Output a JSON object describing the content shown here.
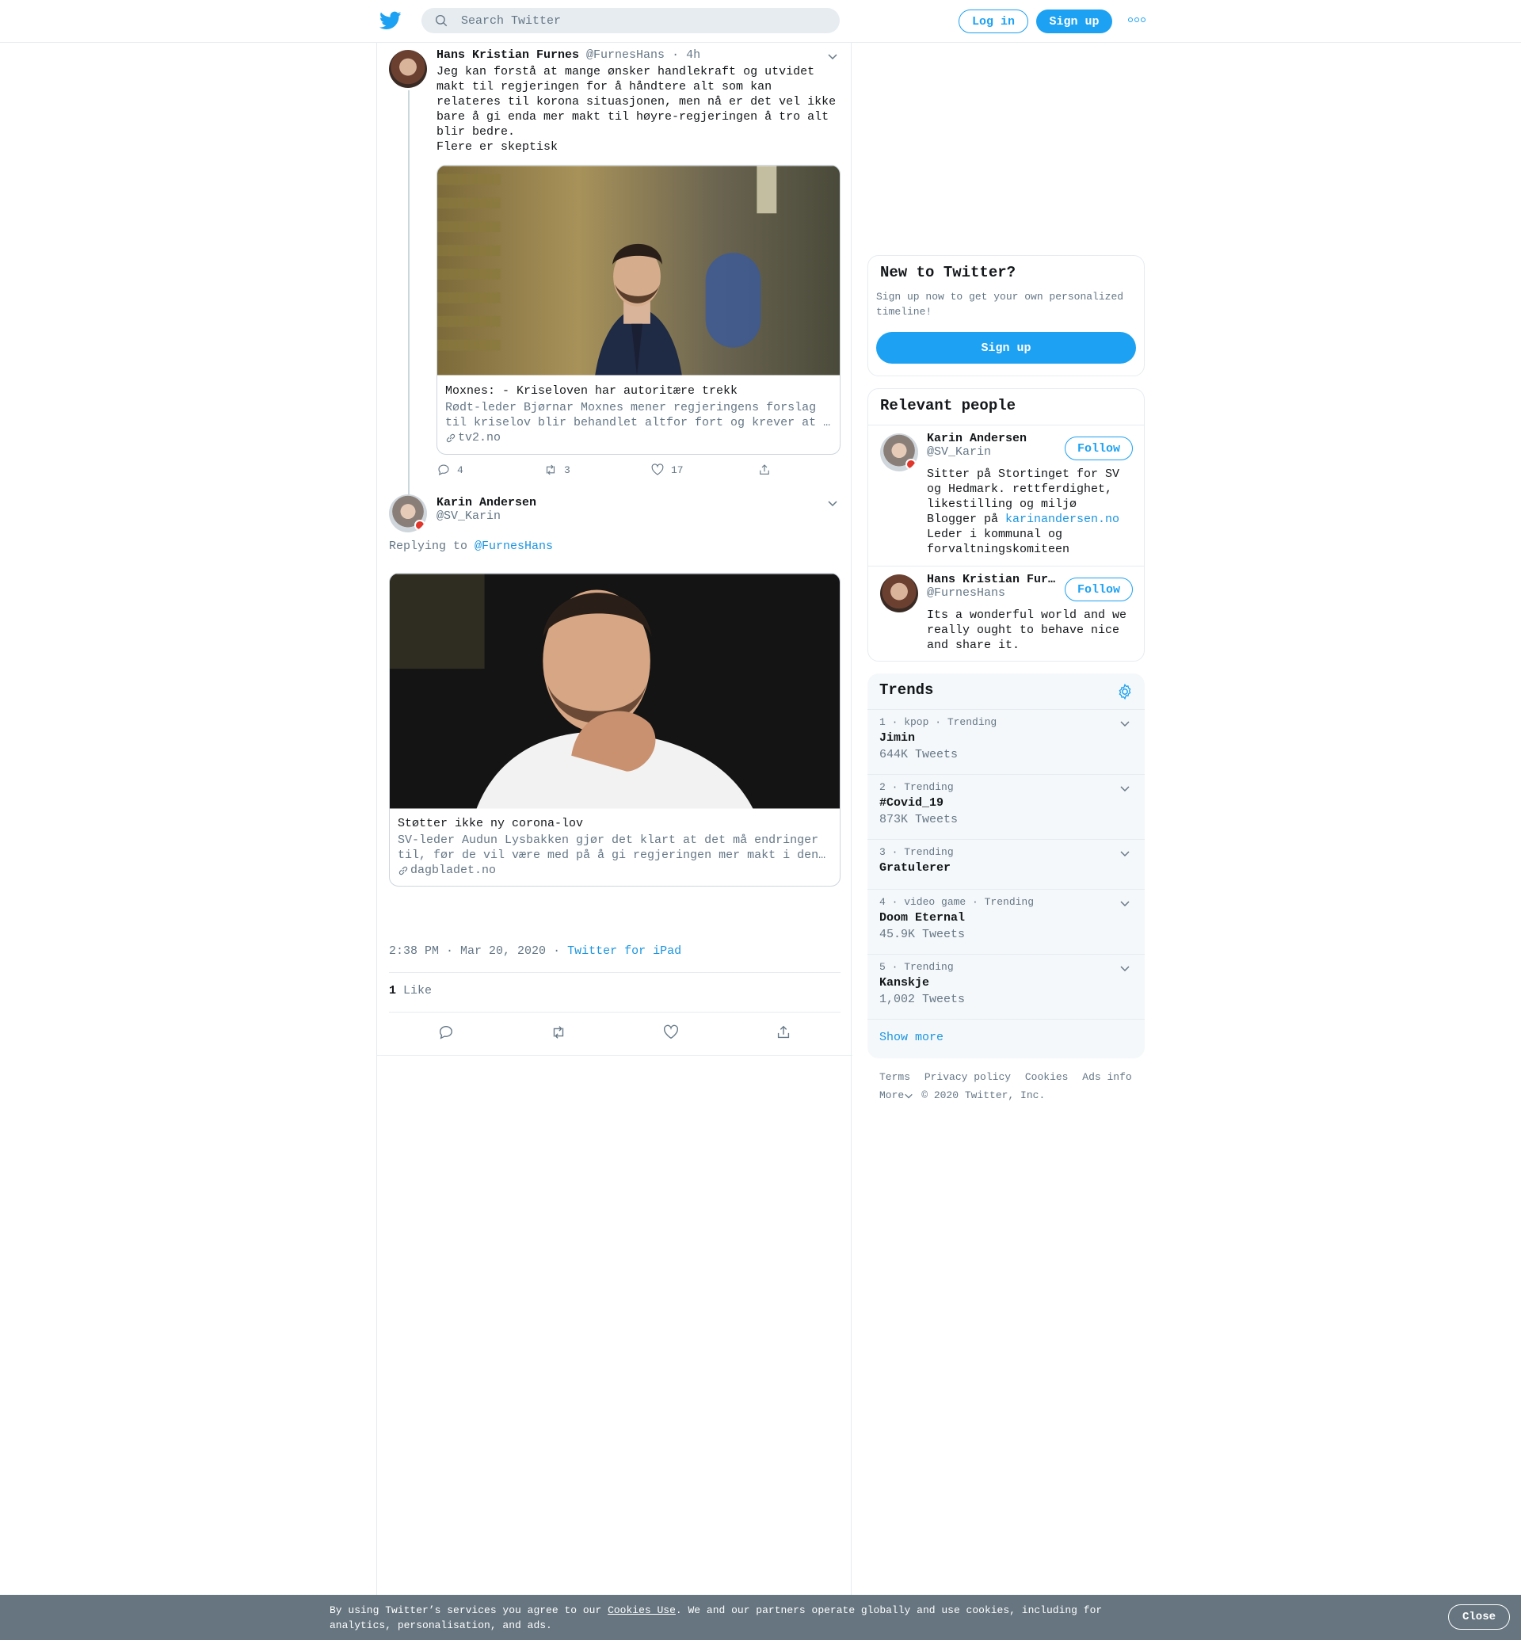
{
  "header": {
    "search_placeholder": "Search Twitter",
    "login_label": "Log in",
    "signup_label": "Sign up"
  },
  "parent_tweet": {
    "name": "Hans Kristian Furnes",
    "handle": "@FurnesHans",
    "time": "· 4h",
    "text": "Jeg kan forstå at mange ønsker handlekraft og utvidet\nmakt til regjeringen for å håndtere alt som kan\nrelateres til korona situasjonen, men nå er det vel ikke\nbare å gi enda mer makt til høyre-regjeringen å tro alt\nblir bedre.\nFlere er skeptisk",
    "card": {
      "title": "Moxnes: - Kriseloven har autoritære trekk",
      "description": "Rødt-leder Bjørnar Moxnes mener regjeringens forslag til kriselov blir behandlet altfor fort og krever at …",
      "domain": "tv2.no"
    },
    "replies": "4",
    "retweets": "3",
    "likes": "17"
  },
  "main_tweet": {
    "name": "Karin Andersen",
    "handle": "@SV_Karin",
    "replying_prefix": "Replying to",
    "replying_to": "@FurnesHans",
    "card": {
      "title": "Støtter ikke ny corona-lov",
      "description": "SV-leder Audun Lysbakken gjør det klart at det må endringer til, før de vil være med på å gi regjeringen mer makt i den…",
      "domain": "dagbladet.no"
    },
    "timestamp": "2:38 PM · Mar 20, 2020",
    "separator": "·",
    "source": "Twitter for iPad",
    "like_count": "1",
    "like_label": "Like"
  },
  "new_to_twitter": {
    "title": "New to Twitter?",
    "text": "Sign up now to get your own personalized timeline!",
    "button": "Sign up"
  },
  "relevant_people": {
    "title": "Relevant people",
    "people": [
      {
        "name": "Karin Andersen",
        "handle": "@SV_Karin",
        "follow": "Follow",
        "bio_before": "Sitter på Stortinget for SV og Hedmark. rettferdighet, likestilling og miljø Blogger på ",
        "bio_link": "karinandersen.no",
        "bio_after": " Leder i kommunal og forvaltningskomiteen"
      },
      {
        "name": "Hans Kristian Fur…",
        "handle": "@FurnesHans",
        "follow": "Follow",
        "bio": "Its a wonderful world and we really ought to behave nice and share it."
      }
    ]
  },
  "trends": {
    "title": "Trends",
    "items": [
      {
        "context": "1 · kpop · Trending",
        "name": "Jimin",
        "count": "644K Tweets"
      },
      {
        "context": "2 · Trending",
        "name": "#Covid_19",
        "count": "873K Tweets"
      },
      {
        "context": "3 · Trending",
        "name": "Gratulerer",
        "count": ""
      },
      {
        "context": "4 · video game · Trending",
        "name": "Doom Eternal",
        "count": "45.9K Tweets"
      },
      {
        "context": "5 · Trending",
        "name": "Kanskje",
        "count": "1,002 Tweets"
      }
    ],
    "show_more": "Show more"
  },
  "footer": {
    "links": [
      "Terms",
      "Privacy policy",
      "Cookies",
      "Ads info"
    ],
    "more": "More",
    "copyright": "© 2020 Twitter, Inc."
  },
  "cookie_bar": {
    "text_before": "By using Twitter’s services you agree to our ",
    "link": "Cookies Use",
    "text_after": ". We and our partners operate globally and use cookies, including for analytics, personalisation, and ads.",
    "close": "Close"
  },
  "colors": {
    "accent": "#1da1f2",
    "link": "#1b95e0",
    "muted": "#657786",
    "cookie_bg": "#66757f"
  }
}
